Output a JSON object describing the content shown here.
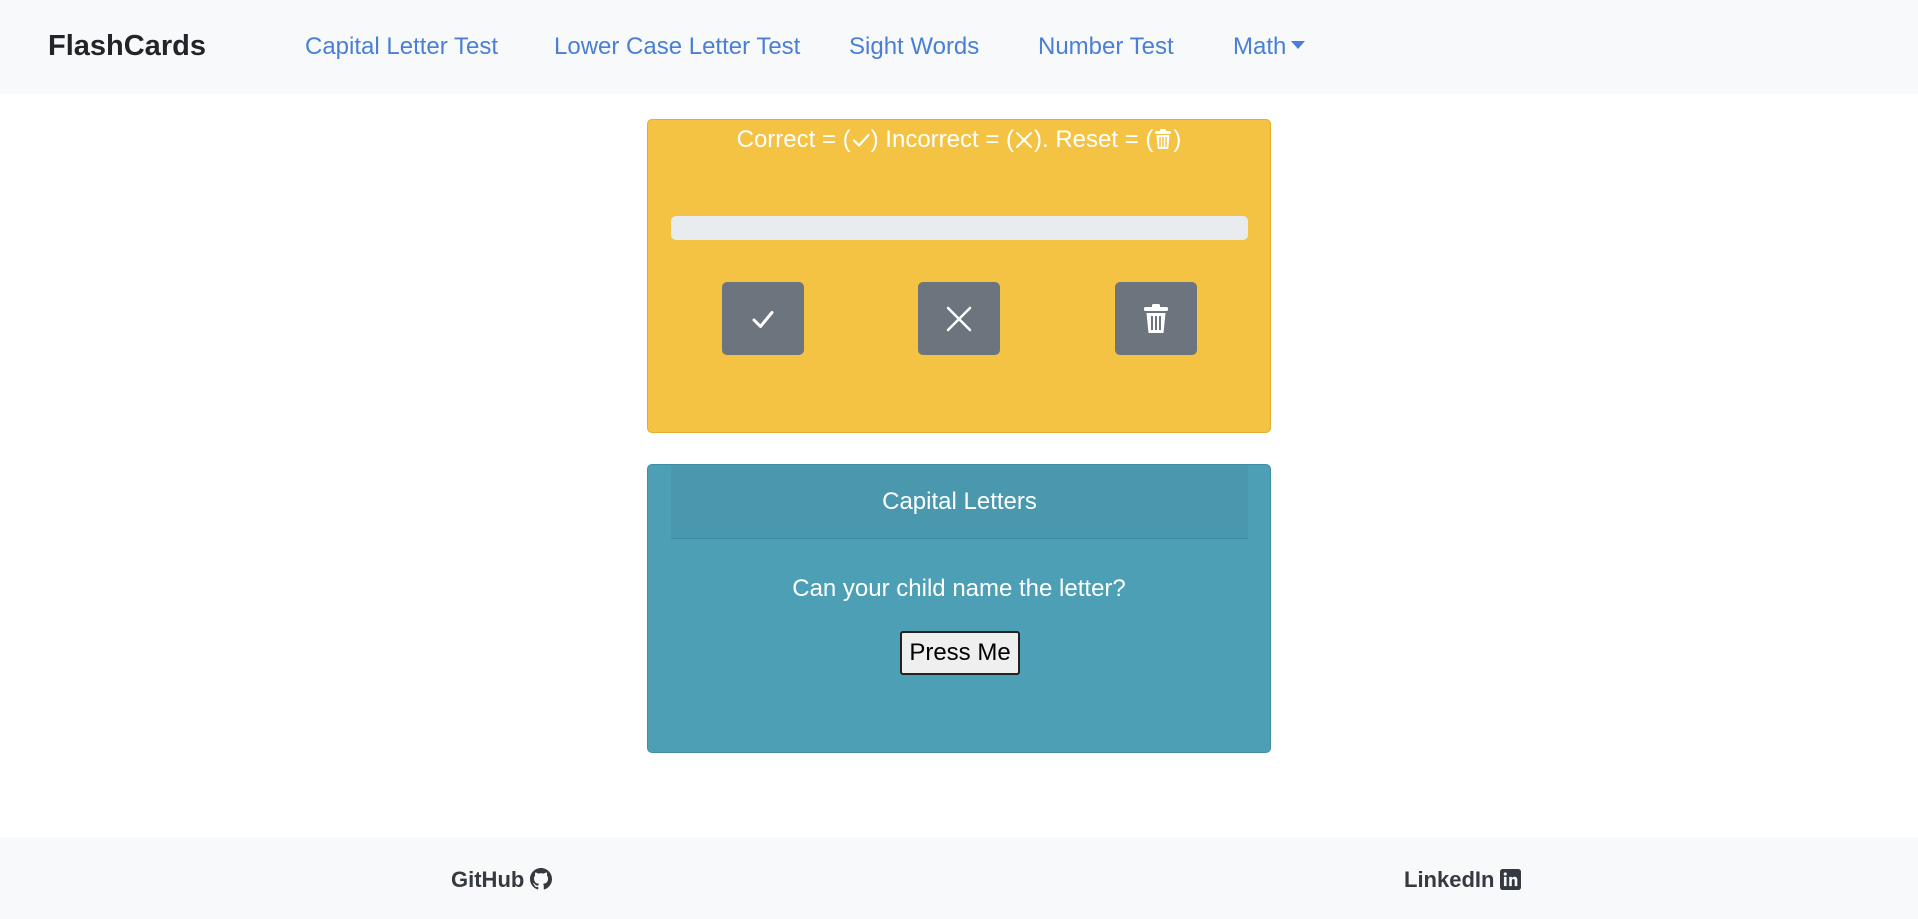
{
  "navbar": {
    "brand": "FlashCards",
    "links": [
      {
        "label": "Capital Letter Test"
      },
      {
        "label": "Lower Case Letter Test"
      },
      {
        "label": "Sight Words"
      },
      {
        "label": "Number Test"
      },
      {
        "label": "Math",
        "dropdown": true
      }
    ],
    "link_color": "#4a7fd4"
  },
  "score_card": {
    "instructions": {
      "correct_text": "Correct = (",
      "incorrect_text": ") Incorrect = (",
      "reset_text": "). Reset = (",
      "close_text": ")"
    },
    "progress": 0,
    "buttons": {
      "correct_icon": "check-icon",
      "incorrect_icon": "x-icon",
      "reset_icon": "trash-icon"
    },
    "bg_color": "#f5c344"
  },
  "letter_card": {
    "header": "Capital Letters",
    "prompt": "Can your child name the letter?",
    "button_label": "Press Me",
    "bg_color": "#4c9fb5"
  },
  "footer": {
    "github_label": "GitHub",
    "github_icon": "github-icon",
    "linkedin_label": "LinkedIn",
    "linkedin_icon": "linkedin-icon"
  }
}
